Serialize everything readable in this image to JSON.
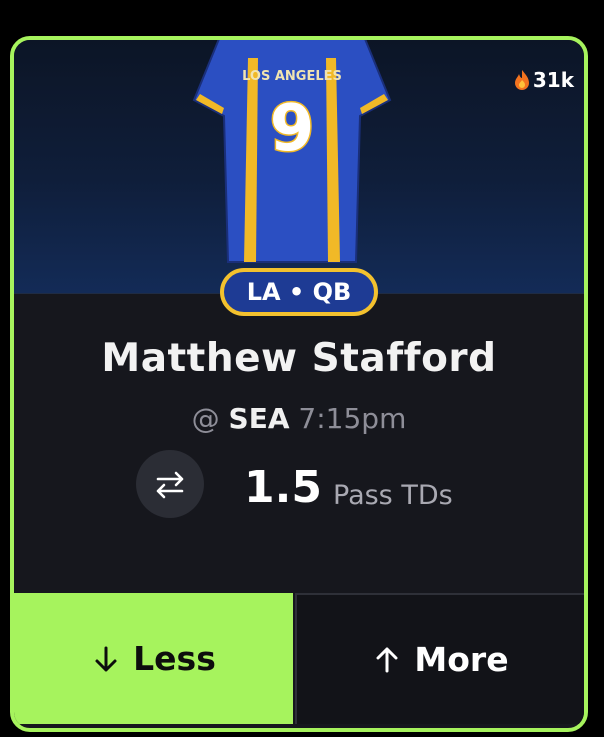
{
  "card": {
    "trend": {
      "icon": "fire-icon",
      "count": "31k"
    },
    "jersey": {
      "team_text": "LOS ANGELES",
      "number": "9",
      "icon": "jersey-image"
    },
    "badge": "LA • QB",
    "player_name": "Matthew Stafford",
    "matchup": {
      "prefix": "@",
      "opponent": "SEA",
      "time": "7:15pm"
    },
    "line": {
      "swap_icon": "swap-arrows-icon",
      "value": "1.5",
      "stat": "Pass TDs"
    },
    "actions": {
      "less_label": "Less",
      "more_label": "More"
    }
  },
  "colors": {
    "accent": "#a6f35d",
    "card_bg": "#16171d",
    "badge_bg": "#1e3b94",
    "badge_border": "#f3c12e",
    "jersey_blue": "#2b4fc2",
    "jersey_gold": "#f1b927"
  }
}
